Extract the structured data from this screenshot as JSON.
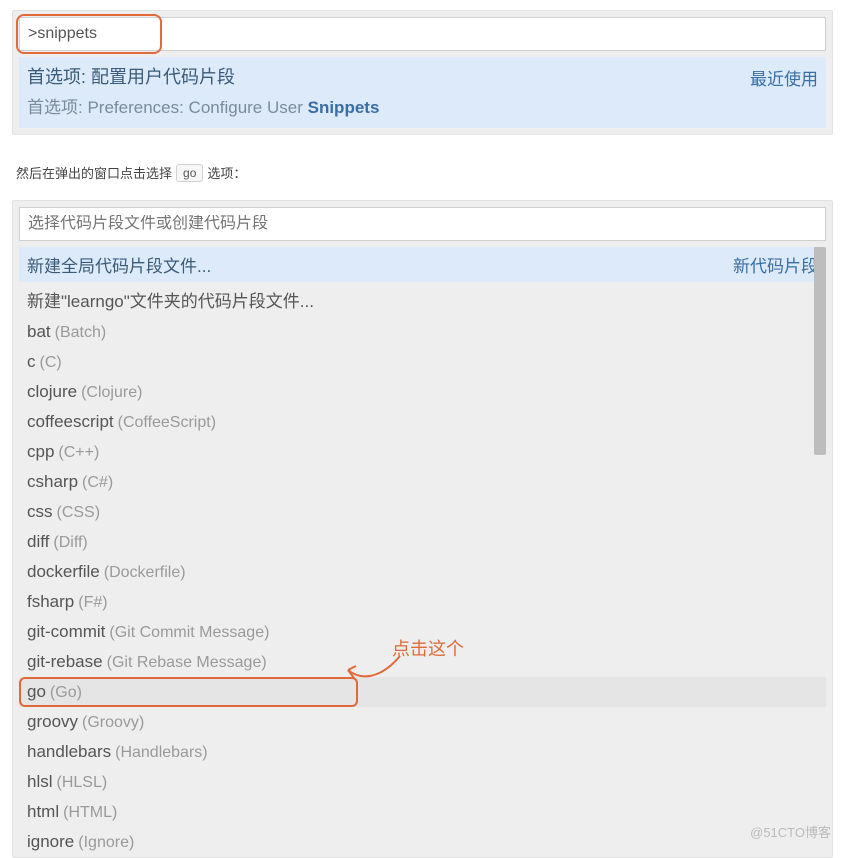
{
  "palette1": {
    "input_value": ">snippets",
    "result": {
      "line1": "首选项: 配置用户代码片段",
      "line2_prefix": "首选项: Preferences: Configure User ",
      "line2_match": "Snippets",
      "right_label": "最近使用"
    }
  },
  "instruction": {
    "before": "然后在弹出的窗口点击选择",
    "kbd": "go",
    "after": "选项："
  },
  "palette2": {
    "placeholder": "选择代码片段文件或创建代码片段",
    "header_row": {
      "label": "新建全局代码片段文件...",
      "badge": "新代码片段"
    },
    "second_row": "新建\"learngo\"文件夹的代码片段文件...",
    "items": [
      {
        "id": "bat",
        "desc": "Batch"
      },
      {
        "id": "c",
        "desc": "C"
      },
      {
        "id": "clojure",
        "desc": "Clojure"
      },
      {
        "id": "coffeescript",
        "desc": "CoffeeScript"
      },
      {
        "id": "cpp",
        "desc": "C++"
      },
      {
        "id": "csharp",
        "desc": "C#"
      },
      {
        "id": "css",
        "desc": "CSS"
      },
      {
        "id": "diff",
        "desc": "Diff"
      },
      {
        "id": "dockerfile",
        "desc": "Dockerfile"
      },
      {
        "id": "fsharp",
        "desc": "F#"
      },
      {
        "id": "git-commit",
        "desc": "Git Commit Message"
      },
      {
        "id": "git-rebase",
        "desc": "Git Rebase Message"
      },
      {
        "id": "go",
        "desc": "Go"
      },
      {
        "id": "groovy",
        "desc": "Groovy"
      },
      {
        "id": "handlebars",
        "desc": "Handlebars"
      },
      {
        "id": "hlsl",
        "desc": "HLSL"
      },
      {
        "id": "html",
        "desc": "HTML"
      },
      {
        "id": "ignore",
        "desc": "Ignore"
      }
    ]
  },
  "annotation": {
    "text": "点击这个"
  },
  "watermark": "@51CTO博客"
}
